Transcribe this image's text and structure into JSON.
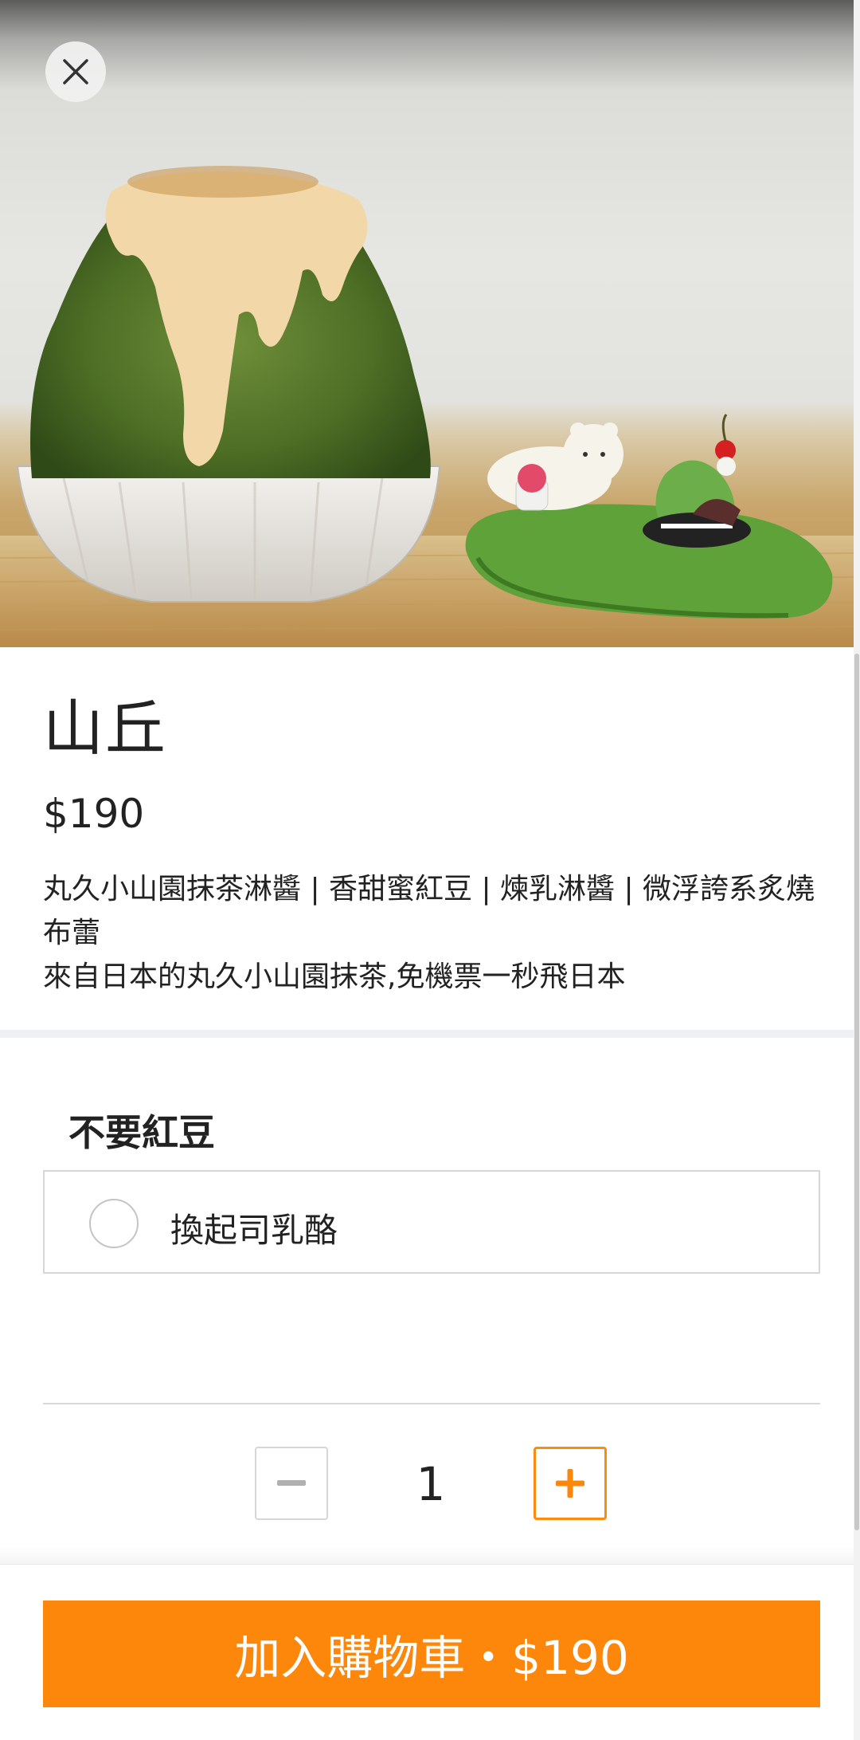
{
  "product": {
    "title": "山丘",
    "price": "$190",
    "description_line1": "丸久小山園抹茶淋醬 | 香甜蜜紅豆 | 煉乳淋醬 | 微浮誇系炙燒布蕾",
    "description_line2": "來自日本的丸久小山園抹茶,免機票一秒飛日本"
  },
  "options": {
    "heading": "不要紅豆",
    "items": [
      {
        "label": "換起司乳酪",
        "selected": false
      }
    ]
  },
  "quantity": {
    "value": "1",
    "minus_icon": "minus-icon",
    "plus_icon": "plus-icon"
  },
  "footer": {
    "cart_button_label": "加入購物車・$190"
  },
  "icons": {
    "close": "close-icon"
  },
  "colors": {
    "accent": "#fc870b",
    "text": "#222222",
    "border": "#d6d6d6",
    "divider_band": "#eef0f4"
  }
}
